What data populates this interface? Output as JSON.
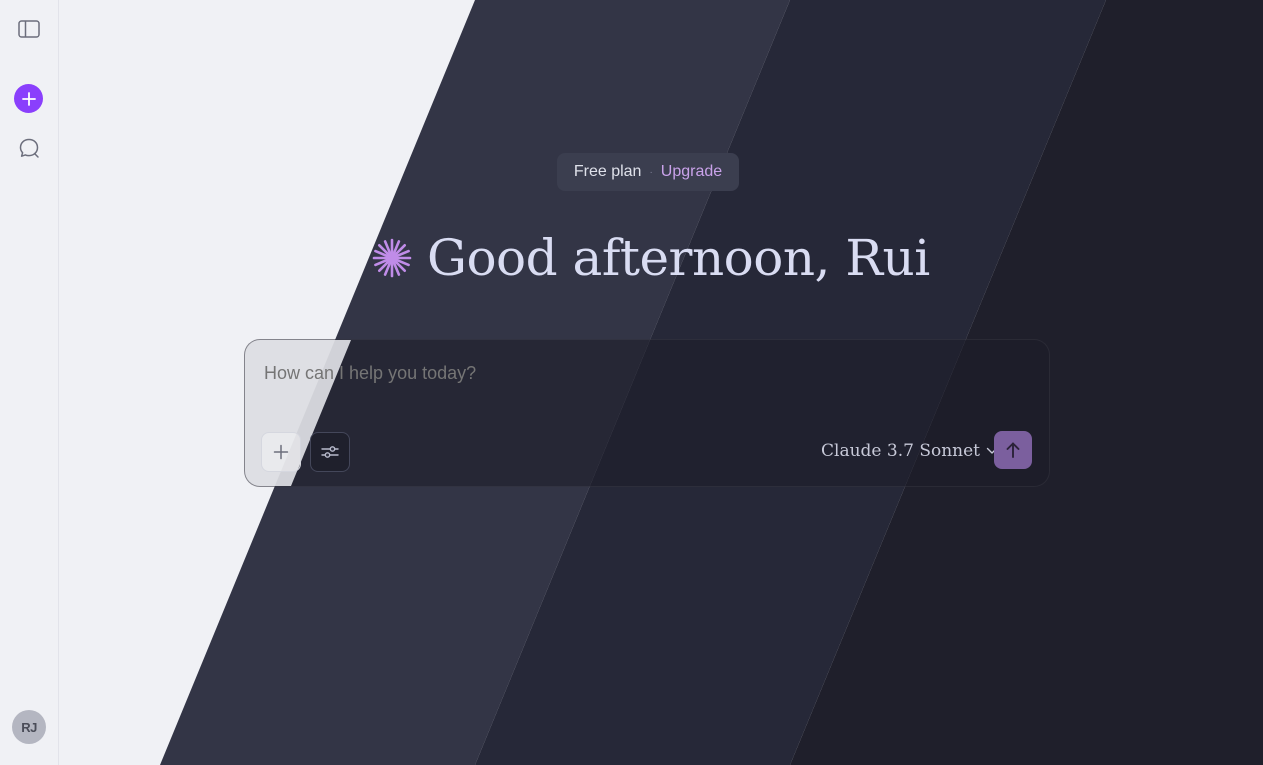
{
  "sidebar": {
    "toggle_icon": "sidebar-toggle-icon",
    "new_chat_icon": "plus-icon",
    "chats_icon": "chat-bubble-icon",
    "avatar_initials": "RJ"
  },
  "plan": {
    "label": "Free plan",
    "separator": "·",
    "upgrade_label": "Upgrade"
  },
  "greeting": {
    "icon": "sparkle-icon",
    "text": "Good afternoon, Rui"
  },
  "composer": {
    "placeholder": "How can I help you today?",
    "attach_icon": "plus-icon",
    "tools_icon": "sliders-icon",
    "model_label": "Claude 3.7 Sonnet",
    "model_icon": "chevron-down-icon",
    "send_icon": "arrow-up-icon"
  },
  "colors": {
    "accent": "#8a3ffc",
    "sparkle": "#c08ce8",
    "upgrade": "#c9a2ea",
    "send_button": "#7b5f9e",
    "dark_bg": "#1f1f2b",
    "light_bg": "#f0f1f5"
  }
}
